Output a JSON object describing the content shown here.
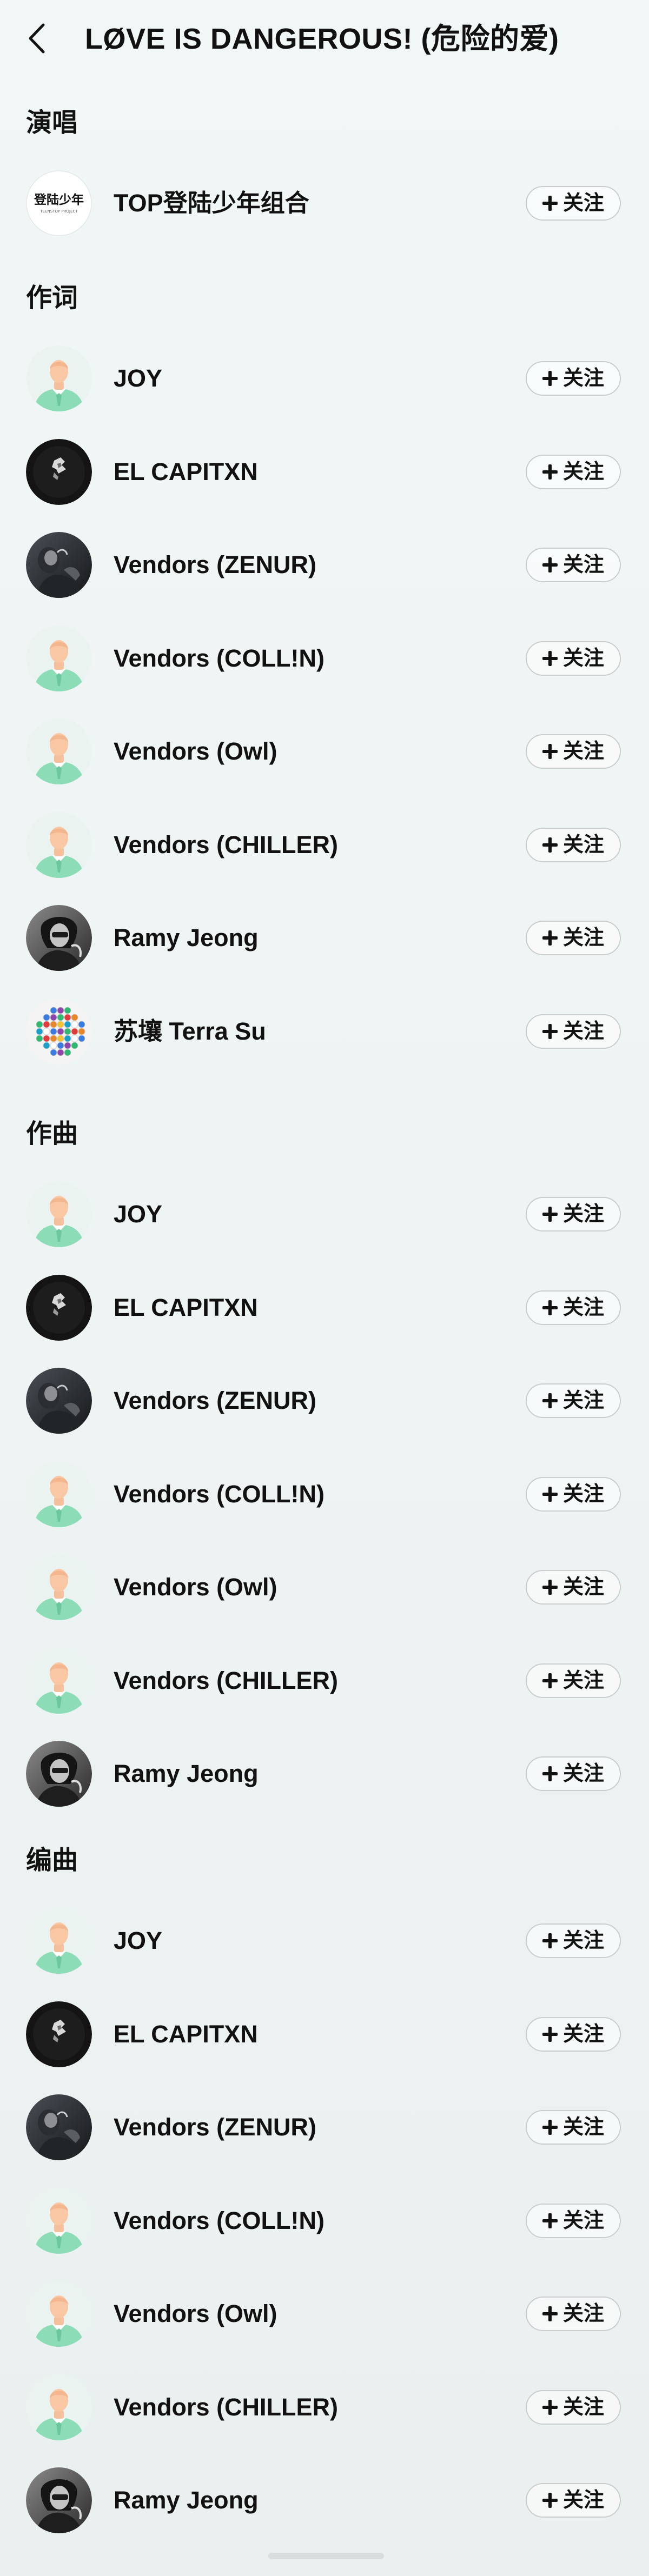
{
  "header": {
    "title": "LØVE IS DANGEROUS! (危险的爱)",
    "back_icon": "chevron-left-icon"
  },
  "follow_label": "关注",
  "sections": [
    {
      "title": "演唱",
      "people": [
        {
          "name": "TOP登陆少年组合",
          "avatar": "top-logo",
          "logo_text": "登陆少年",
          "logo_subtext": "TEENSTOP PROJECT"
        }
      ]
    },
    {
      "title": "作词",
      "people": [
        {
          "name": "JOY",
          "avatar": "default-avatar"
        },
        {
          "name": "EL CAPITXN",
          "avatar": "dark-avatar"
        },
        {
          "name": "Vendors (ZENUR)",
          "avatar": "photo-avatar"
        },
        {
          "name": "Vendors (COLL!N)",
          "avatar": "default-avatar"
        },
        {
          "name": "Vendors (Owl)",
          "avatar": "default-avatar"
        },
        {
          "name": "Vendors (CHILLER)",
          "avatar": "default-avatar"
        },
        {
          "name": "Ramy Jeong",
          "avatar": "bw-photo-avatar"
        },
        {
          "name": "苏壤 Terra Su",
          "avatar": "beads-avatar"
        }
      ]
    },
    {
      "title": "作曲",
      "people": [
        {
          "name": "JOY",
          "avatar": "default-avatar"
        },
        {
          "name": "EL CAPITXN",
          "avatar": "dark-avatar"
        },
        {
          "name": "Vendors (ZENUR)",
          "avatar": "photo-avatar"
        },
        {
          "name": "Vendors (COLL!N)",
          "avatar": "default-avatar"
        },
        {
          "name": "Vendors (Owl)",
          "avatar": "default-avatar"
        },
        {
          "name": "Vendors (CHILLER)",
          "avatar": "default-avatar"
        },
        {
          "name": "Ramy Jeong",
          "avatar": "bw-photo-avatar"
        }
      ]
    },
    {
      "title": "编曲",
      "people": [
        {
          "name": "JOY",
          "avatar": "default-avatar"
        },
        {
          "name": "EL CAPITXN",
          "avatar": "dark-avatar"
        },
        {
          "name": "Vendors (ZENUR)",
          "avatar": "photo-avatar"
        },
        {
          "name": "Vendors (COLL!N)",
          "avatar": "default-avatar"
        },
        {
          "name": "Vendors (Owl)",
          "avatar": "default-avatar"
        },
        {
          "name": "Vendors (CHILLER)",
          "avatar": "default-avatar"
        },
        {
          "name": "Ramy Jeong",
          "avatar": "bw-photo-avatar"
        }
      ]
    }
  ]
}
